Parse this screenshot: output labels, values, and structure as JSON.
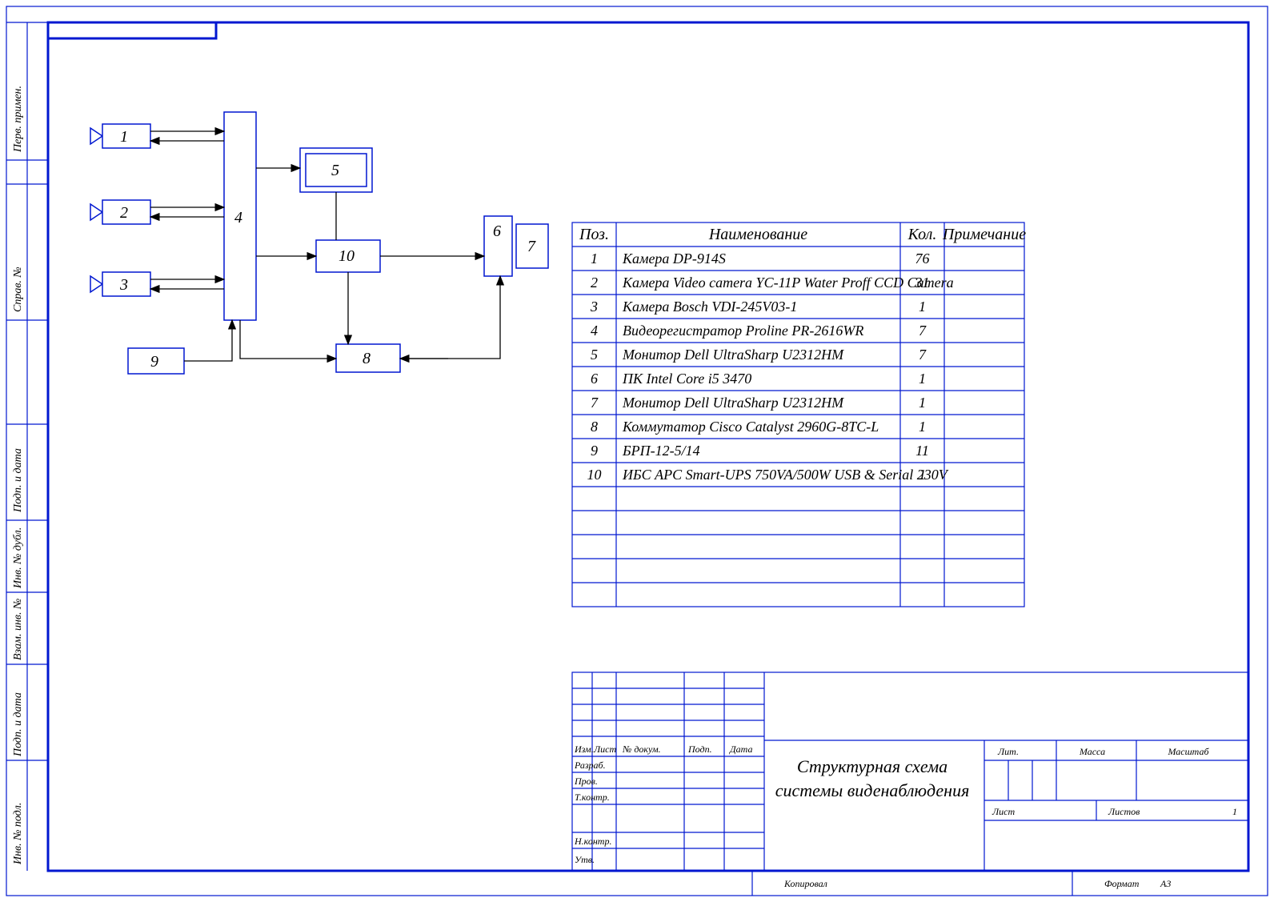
{
  "side_labels": [
    "Перв. примен.",
    "Справ. №",
    "Подп. и дата",
    "Инв. № дубл.",
    "Взам. инв. №",
    "Подп. и дата",
    "Инв. № подл."
  ],
  "diagram_numbers": [
    "1",
    "2",
    "3",
    "4",
    "5",
    "6",
    "7",
    "8",
    "9",
    "10"
  ],
  "table_headers": {
    "pos": "Поз.",
    "name": "Наименование",
    "qty": "Кол.",
    "note": "Примечание"
  },
  "table_rows": [
    {
      "pos": "1",
      "name": "Камера DP-914S",
      "qty": "76",
      "note": ""
    },
    {
      "pos": "2",
      "name": "Камера Video camera YC-11P Water Proff CCD Camera",
      "qty": "31",
      "note": ""
    },
    {
      "pos": "3",
      "name": "Камера Bosch VDI-245V03-1",
      "qty": "1",
      "note": ""
    },
    {
      "pos": "4",
      "name": "Видеорегистратор Proline PR-2616WR",
      "qty": "7",
      "note": ""
    },
    {
      "pos": "5",
      "name": "Монитор Dell UltraSharp U2312HM",
      "qty": "7",
      "note": ""
    },
    {
      "pos": "6",
      "name": "ПК Intel Core i5 3470",
      "qty": "1",
      "note": ""
    },
    {
      "pos": "7",
      "name": "Монитор Dell UltraSharp U2312HM",
      "qty": "1",
      "note": ""
    },
    {
      "pos": "8",
      "name": "Коммутатор Cisco Catalyst 2960G-8TC-L",
      "qty": "1",
      "note": ""
    },
    {
      "pos": "9",
      "name": "БРП-12-5/14",
      "qty": "11",
      "note": ""
    },
    {
      "pos": "10",
      "name": "ИБС APC Smart-UPS 750VA/500W USB & Serial 230V",
      "qty": "1",
      "note": ""
    }
  ],
  "stamp": {
    "izm": "Изм.",
    "list": "Лист",
    "ndoc": "№ докум.",
    "podp": "Подп.",
    "data": "Дата",
    "razrab": "Разраб.",
    "prov": "Пров.",
    "tkontr": "Т.контр.",
    "nkontr": "Н.контр.",
    "utv": "Утв.",
    "lit": "Лит.",
    "massa": "Масса",
    "mashtab": "Масштаб",
    "list2": "Лист",
    "listov": "Листов",
    "listov_val": "1",
    "title_l1": "Структурная схема",
    "title_l2": "системы виденаблюдения",
    "kopiroval": "Копировал",
    "format": "Формат",
    "format_val": "А3"
  }
}
